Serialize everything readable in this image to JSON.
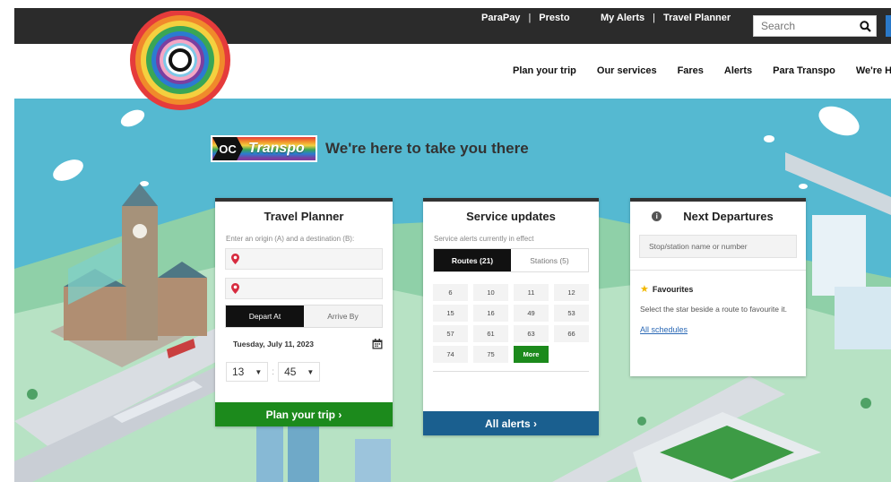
{
  "colors": {
    "topbar": "#2b2b2b",
    "hero": "#4fb7cf",
    "primary_green": "#1c8a1c",
    "alerts_blue": "#1a5f8f",
    "link": "#2a68b5"
  },
  "topbar": {
    "links": [
      "ParaPay",
      "Presto",
      "My Alerts",
      "Travel Planner"
    ],
    "separator": "|",
    "search_placeholder": "Search",
    "search_icon": "search-icon"
  },
  "nav": {
    "items": [
      "Plan your trip",
      "Our services",
      "Fares",
      "Alerts",
      "Para Transpo",
      "We're Hiring"
    ]
  },
  "brand": {
    "oc": "OC",
    "word": "Transpo",
    "tagline": "We're here to take you there"
  },
  "planner": {
    "title": "Travel Planner",
    "hint": "Enter an origin (A) and a destination (B):",
    "depart_label": "Depart At",
    "arrive_label": "Arrive By",
    "date": "Tuesday, July 11, 2023",
    "hour": "13",
    "minute": "45",
    "plan_button": "Plan your trip ›"
  },
  "updates": {
    "title": "Service updates",
    "hint": "Service alerts currently in effect",
    "tab_routes": "Routes (21)",
    "tab_stations": "Stations (5)",
    "routes": [
      "6",
      "10",
      "11",
      "12",
      "15",
      "16",
      "49",
      "53",
      "57",
      "61",
      "63",
      "66",
      "74",
      "75"
    ],
    "more_label": "More",
    "all_button": "All alerts ›"
  },
  "next": {
    "title": "Next Departures",
    "info": "i",
    "stop_placeholder": "Stop/station name or number",
    "fav_title": "Favourites",
    "fav_text": "Select the star beside a route to favourite it.",
    "schedules_link": "All schedules"
  }
}
